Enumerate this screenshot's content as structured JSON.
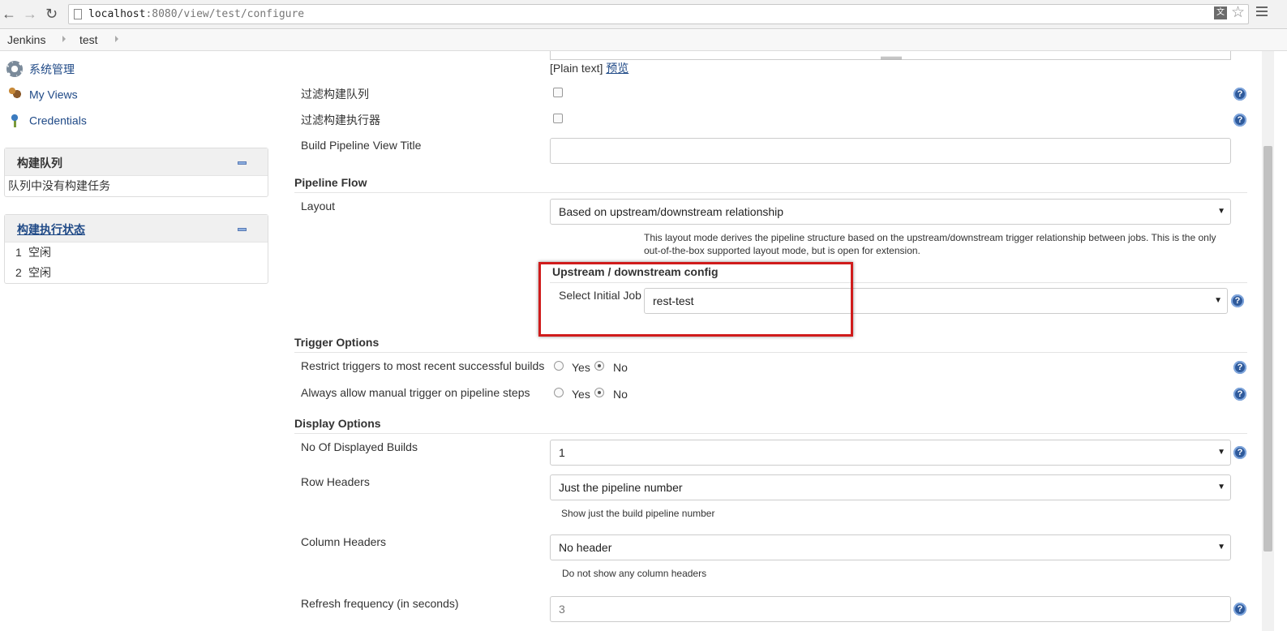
{
  "browser": {
    "url_host": "localhost",
    "url_rest": ":8080/view/test/configure",
    "back_icon": "back-arrow-icon",
    "forward_icon": "forward-arrow-icon",
    "reload_icon": "reload-icon"
  },
  "breadcrumb": {
    "items": [
      "Jenkins",
      "test"
    ]
  },
  "sidebar": {
    "links": [
      {
        "label": "系统管理",
        "icon": "gear-icon"
      },
      {
        "label": "My Views",
        "icon": "users-icon"
      },
      {
        "label": "Credentials",
        "icon": "credentials-icon"
      }
    ],
    "build_queue": {
      "title": "构建队列",
      "empty_text": "队列中没有构建任务"
    },
    "executor_status": {
      "title": "构建执行状态",
      "executors": [
        {
          "num": "1",
          "status": "空闲"
        },
        {
          "num": "2",
          "status": "空闲"
        }
      ]
    }
  },
  "form": {
    "plain_text": "[Plain text]",
    "preview_link": "预览",
    "filter_queue_label": "过滤构建队列",
    "filter_executors_label": "过滤构建执行器",
    "view_title_label": "Build Pipeline View Title",
    "view_title_value": "",
    "pipeline_flow": {
      "title": "Pipeline Flow",
      "layout_label": "Layout",
      "layout_value": "Based on upstream/downstream relationship",
      "layout_desc": "This layout mode derives the pipeline structure based on the upstream/downstream trigger relationship between jobs. This is the only out-of-the-box supported layout mode, but is open for extension.",
      "upstream_title": "Upstream / downstream config",
      "initial_job_label": "Select Initial Job",
      "initial_job_value": "rest-test"
    },
    "trigger_options": {
      "title": "Trigger Options",
      "restrict_label": "Restrict triggers to most recent successful builds",
      "manual_label": "Always allow manual trigger on pipeline steps",
      "yes": "Yes",
      "no": "No",
      "restrict_value": "No",
      "manual_value": "No"
    },
    "display_options": {
      "title": "Display Options",
      "num_builds_label": "No Of Displayed Builds",
      "num_builds_value": "1",
      "row_headers_label": "Row Headers",
      "row_headers_value": "Just the pipeline number",
      "row_headers_desc": "Show just the build pipeline number",
      "column_headers_label": "Column Headers",
      "column_headers_value": "No header",
      "column_headers_desc": "Do not show any column headers",
      "refresh_label": "Refresh frequency (in seconds)",
      "refresh_value": "3"
    }
  },
  "colors": {
    "link": "#204a87",
    "highlight": "#d01c1c",
    "help_icon": "#2f5a9b"
  }
}
